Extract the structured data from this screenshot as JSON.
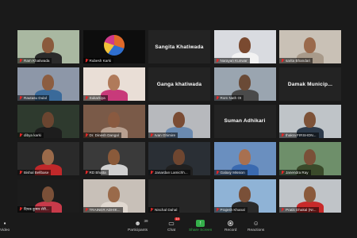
{
  "tiles": [
    {
      "name": "Ram Khatiwada",
      "bg": "#a9b8a1",
      "skin": "#8a5a3c",
      "shirt": "#2a2a2a",
      "kind": "video"
    },
    {
      "name": "Rubesh Karki",
      "bg": "#0d0d0d",
      "skin": "#e0692a",
      "shirt": "#2f6fd0",
      "kind": "logo"
    },
    {
      "name": "Sangita  Khatiwada",
      "kind": "name"
    },
    {
      "name": "Narayan Kunwar",
      "bg": "#d9dbe0",
      "skin": "#7a4a30",
      "shirt": "#f2f2f2",
      "kind": "video"
    },
    {
      "name": "sarita Bhandari",
      "bg": "#c9c1b6",
      "skin": "#9a6a4c",
      "shirt": "#a89a8a",
      "kind": "video"
    },
    {
      "name": "Rautasu Dulal",
      "bg": "#8d97a8",
      "skin": "#8c5d40",
      "shirt": "#3a6a9a",
      "kind": "video"
    },
    {
      "name": "Sukarkiya",
      "bg": "#e9ded6",
      "skin": "#b07a5a",
      "shirt": "#c83a7a",
      "kind": "video"
    },
    {
      "name": "Ganga khatiwada",
      "kind": "name"
    },
    {
      "name": "Rom Nath OI",
      "bg": "#9aa5b0",
      "skin": "#6a4a36",
      "shirt": "#4a4a4a",
      "kind": "video"
    },
    {
      "name": "Damak  Municip...",
      "kind": "name"
    },
    {
      "name": "dibya karki",
      "bg": "#2e3a2e",
      "skin": "#6a4530",
      "shirt": "#1d1d1d",
      "kind": "video"
    },
    {
      "name": "Dr. Dinesh Dangal",
      "bg": "#7a5a48",
      "skin": "#8a5a40",
      "shirt": "#b8a090",
      "kind": "video"
    },
    {
      "name": "Ivan Ghimire",
      "bg": "#b7b9bd",
      "skin": "#7a4c34",
      "shirt": "#6a8ab0",
      "kind": "video",
      "active": true
    },
    {
      "name": "Suman Adhikari",
      "kind": "name"
    },
    {
      "name": "thakra FIRSHON...",
      "bg": "#bfc4c8",
      "skin": "#7d5238",
      "shirt": "#2d3a4a",
      "kind": "video"
    },
    {
      "name": "Bishal Bellbase",
      "bg": "#2a2a2a",
      "skin": "#9a6a4a",
      "shirt": "#c0282a",
      "kind": "video"
    },
    {
      "name": "RD Bhatta",
      "bg": "#3a3a3a",
      "skin": "#8a5a3a",
      "shirt": "#d0d0d0",
      "kind": "video"
    },
    {
      "name": "Janardan Lamichh...",
      "bg": "#2a2f35",
      "skin": "#6e4630",
      "shirt": "#202020",
      "kind": "video"
    },
    {
      "name": "Galaxy Mission",
      "bg": "#6a8fbf",
      "skin": "#a87050",
      "shirt": "#3a6ab0",
      "kind": "video"
    },
    {
      "name": "Janendra Ray",
      "bg": "#6e8f6a",
      "skin": "#7a5038",
      "shirt": "#3a4a2a",
      "kind": "video"
    },
    {
      "name": "दिपक कुमार शेरी...",
      "bg": "#1c1c1c",
      "skin": "#7a5038",
      "shirt": "#c83a4a",
      "kind": "video"
    },
    {
      "name": "TRAINER ADHIK...",
      "bg": "#c8c0b8",
      "skin": "#9a6a4a",
      "shirt": "#e0d8d0",
      "kind": "video"
    },
    {
      "name": "Nischal Dahal",
      "bg": "#262626",
      "skin": "#262626",
      "shirt": "#262626",
      "kind": "dark"
    },
    {
      "name": "Prajesh Khanal",
      "bg": "#8fb3d6",
      "skin": "#7a5038",
      "shirt": "#2a2a2a",
      "kind": "video"
    },
    {
      "name": "Pratik Dhakal (Nr...",
      "bg": "#c0c4c8",
      "skin": "#8a5a3c",
      "shirt": "#c82a2a",
      "kind": "video"
    }
  ],
  "toolbar": {
    "video_label": "Video",
    "participants_label": "Participants",
    "participants_count": "39",
    "chat_label": "Chat",
    "chat_badge": "14",
    "share_label": "Share Screen",
    "record_label": "Record",
    "reactions_label": "Reactions"
  },
  "colors": {
    "background": "#1a1a1a",
    "active_speaker": "#7fd13b",
    "share_green": "#34b04a",
    "mute_red": "#e02828"
  }
}
